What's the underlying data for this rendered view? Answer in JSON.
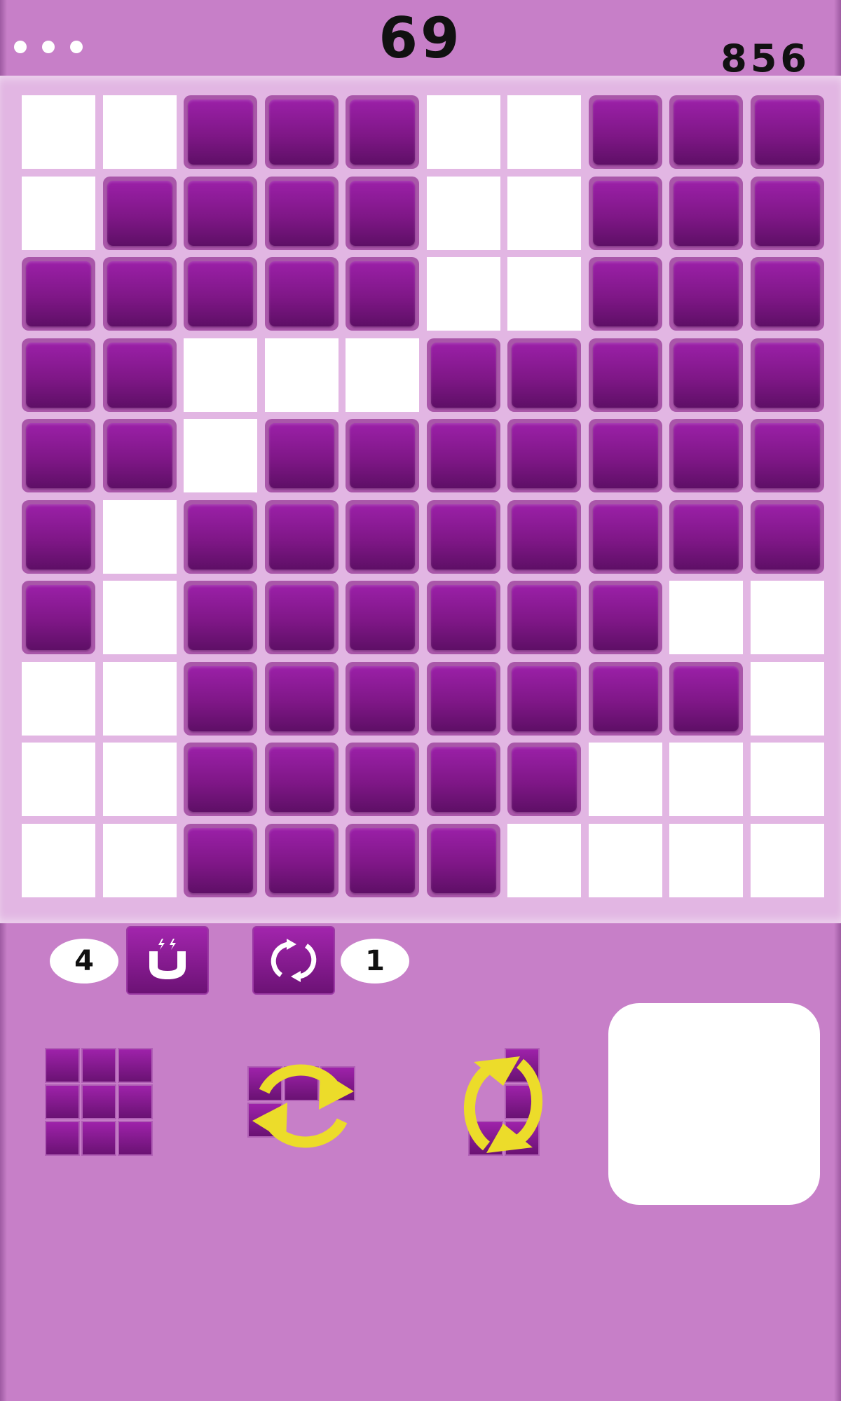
{
  "header": {
    "menu_icon": "more-dots-icon",
    "moves": "69",
    "score": "856"
  },
  "colors": {
    "background": "#c77fc8",
    "board": "#e2b6e3",
    "empty_cell": "#ffffff",
    "tile": "#8a1a93",
    "rotate_arrows": "#ecdc2a"
  },
  "board": {
    "rows": 10,
    "cols": 10,
    "grid": [
      [
        0,
        0,
        1,
        1,
        1,
        0,
        0,
        1,
        1,
        1
      ],
      [
        0,
        1,
        1,
        1,
        1,
        0,
        0,
        1,
        1,
        1
      ],
      [
        1,
        1,
        1,
        1,
        1,
        0,
        0,
        1,
        1,
        1
      ],
      [
        1,
        1,
        0,
        0,
        0,
        1,
        1,
        1,
        1,
        1
      ],
      [
        1,
        1,
        0,
        1,
        1,
        1,
        1,
        1,
        1,
        1
      ],
      [
        1,
        0,
        1,
        1,
        1,
        1,
        1,
        1,
        1,
        1
      ],
      [
        1,
        0,
        1,
        1,
        1,
        1,
        1,
        1,
        0,
        0
      ],
      [
        0,
        0,
        1,
        1,
        1,
        1,
        1,
        1,
        1,
        0
      ],
      [
        0,
        0,
        1,
        1,
        1,
        1,
        1,
        0,
        0,
        0
      ],
      [
        0,
        0,
        1,
        1,
        1,
        1,
        0,
        0,
        0,
        0
      ]
    ]
  },
  "powerups": {
    "magnet": {
      "count": "4",
      "icon": "magnet-icon"
    },
    "rotate": {
      "count": "1",
      "icon": "rotate-icon"
    }
  },
  "tray": {
    "pieces": [
      {
        "name": "square-3x3",
        "cells": [
          [
            0,
            0
          ],
          [
            1,
            0
          ],
          [
            2,
            0
          ],
          [
            0,
            1
          ],
          [
            1,
            1
          ],
          [
            2,
            1
          ],
          [
            0,
            2
          ],
          [
            1,
            2
          ],
          [
            2,
            2
          ]
        ],
        "rotatable": false
      },
      {
        "name": "l-piece-horizontal",
        "cells": [
          [
            0,
            0
          ],
          [
            1,
            0
          ],
          [
            2,
            0
          ],
          [
            0,
            1
          ]
        ],
        "rotatable": true
      },
      {
        "name": "l-piece-vertical",
        "cells": [
          [
            1,
            0
          ],
          [
            1,
            1
          ],
          [
            0,
            2
          ],
          [
            1,
            2
          ]
        ],
        "rotatable": true
      }
    ],
    "hold_slot": "empty"
  }
}
